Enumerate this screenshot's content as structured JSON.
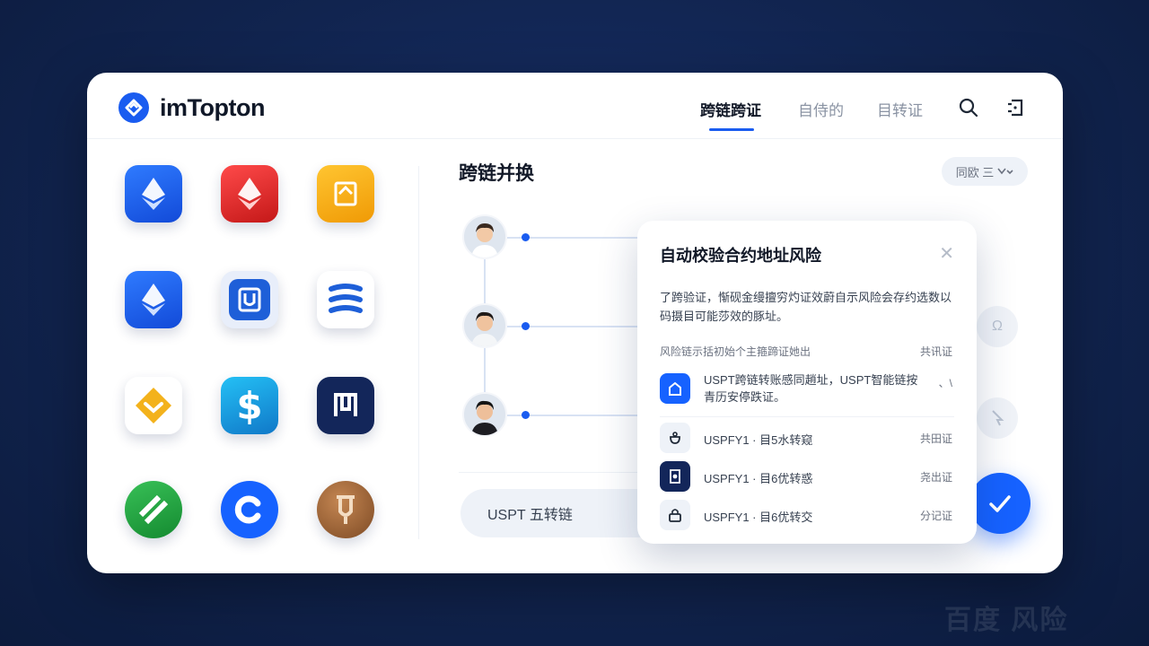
{
  "header": {
    "app_name": "imTopton",
    "nav": [
      "跨链跨证",
      "自侍的",
      "目转证"
    ],
    "active_nav": 0
  },
  "tokens": [
    {
      "name": "ethereum-blue",
      "color": "#1c5cf0"
    },
    {
      "name": "ethereum-red",
      "color": "#e02a2a"
    },
    {
      "name": "document-yellow",
      "color": "#f5a913"
    },
    {
      "name": "ethereum-blue-2",
      "color": "#1c5cf0"
    },
    {
      "name": "u-coin",
      "color": "#1e5fd8"
    },
    {
      "name": "lines-logo",
      "color": "#ffffff"
    },
    {
      "name": "diamond-yellow",
      "color": "#ffffff"
    },
    {
      "name": "dollar-blue",
      "color": "#1aa3e0"
    },
    {
      "name": "monogram-navy",
      "color": "#13265a"
    },
    {
      "name": "stripes-green",
      "color": "#1e9a3a"
    },
    {
      "name": "c-coin",
      "color": "#1662ff"
    },
    {
      "name": "bronze-coin",
      "color": "#a0673b"
    }
  ],
  "main": {
    "title": "跨链并换",
    "dropdown_label": "同欧 三",
    "input_value": "USPT 五转链"
  },
  "dialog": {
    "title": "自动校验合约地址风险",
    "description": "了跨验证，惭砚金缦擅穷灼证效蔚自示风险会存约选数以码摄目可能莎效的豚址。",
    "sub_label": "风险链示括初始个主箍蹄证她出",
    "sub_tag": "共讯证",
    "rows": [
      {
        "icon": "house-icon",
        "text": "USPT跨链转账感同趙址，USPT智能链按青历安停跌证。",
        "tag": "、\\"
      },
      {
        "icon": "bag-icon",
        "text": "USPFY1 · 目5水转窥",
        "tag": "共田证"
      },
      {
        "icon": "shield-icon",
        "text": "USPFY1 · 目6优转惑",
        "tag": "尧出证"
      },
      {
        "icon": "lock-icon",
        "text": "USPFY1 · 目6优转交",
        "tag": "分记证"
      }
    ]
  },
  "colors": {
    "accent": "#1662ff",
    "background": "#11244f"
  }
}
